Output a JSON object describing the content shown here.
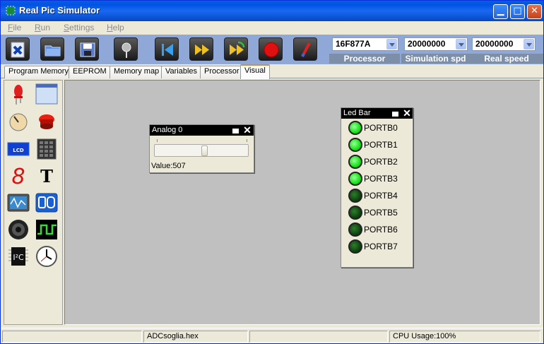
{
  "window": {
    "title": "Real Pic Simulator",
    "minimize_glyph": "▁",
    "maximize_glyph": "□",
    "close_glyph": "✕"
  },
  "menu": [
    {
      "label": "File",
      "accel": "F",
      "rest": "ile"
    },
    {
      "label": "Run",
      "accel": "R",
      "rest": "un"
    },
    {
      "label": "Settings",
      "accel": "S",
      "rest": "ettings"
    },
    {
      "label": "Help",
      "accel": "H",
      "rest": "elp"
    }
  ],
  "toolbar": {
    "buttons": [
      "close-file-icon",
      "open-folder-icon",
      "save-disk-icon",
      "probe-icon",
      "rewind-icon",
      "fast-forward-icon",
      "step-icon",
      "stop-icon",
      "info-icon"
    ],
    "processor": {
      "label": "Processor",
      "value": "16F877A"
    },
    "simulation_spd": {
      "label": "Simulation spd",
      "value": "20000000"
    },
    "real_speed": {
      "label": "Real speed",
      "value": "20000000"
    }
  },
  "tabs": [
    {
      "label": "Program Memory",
      "active": false
    },
    {
      "label": "EEPROM",
      "active": false
    },
    {
      "label": "Memory map",
      "active": false
    },
    {
      "label": "Variables",
      "active": false
    },
    {
      "label": "Processor",
      "active": false
    },
    {
      "label": "Visual",
      "active": true
    }
  ],
  "palette": [
    "led-icon",
    "window-icon",
    "potentiometer-icon",
    "push-button-icon",
    "lcd-icon",
    "keypad-icon",
    "seven-segment-icon",
    "text-icon",
    "oscilloscope-icon",
    "switch-icon",
    "speaker-icon",
    "signal-generator-icon",
    "i2c-icon",
    "clock-icon"
  ],
  "palette_text": {
    "lcd": "LCD",
    "seven_segment": "8",
    "text": "T",
    "i2c": "I²C"
  },
  "analog_panel": {
    "title": "Analog 0",
    "value_label": "Value:507",
    "value": 507
  },
  "led_panel": {
    "title": "Led Bar",
    "leds": [
      {
        "label": "PORTB0",
        "state": "on"
      },
      {
        "label": "PORTB1",
        "state": "on"
      },
      {
        "label": "PORTB2",
        "state": "on"
      },
      {
        "label": "PORTB3",
        "state": "on"
      },
      {
        "label": "PORTB4",
        "state": "off"
      },
      {
        "label": "PORTB5",
        "state": "off"
      },
      {
        "label": "PORTB6",
        "state": "off"
      },
      {
        "label": "PORTB7",
        "state": "off"
      }
    ]
  },
  "status": {
    "file": "ADCsoglia.hex",
    "cpu": "CPU Usage:100%"
  },
  "colors": {
    "led_on": "#1ee61e",
    "led_off": "#0b3d0b",
    "canvas": "#c0c0c0",
    "title_bar": "#0054e3"
  }
}
